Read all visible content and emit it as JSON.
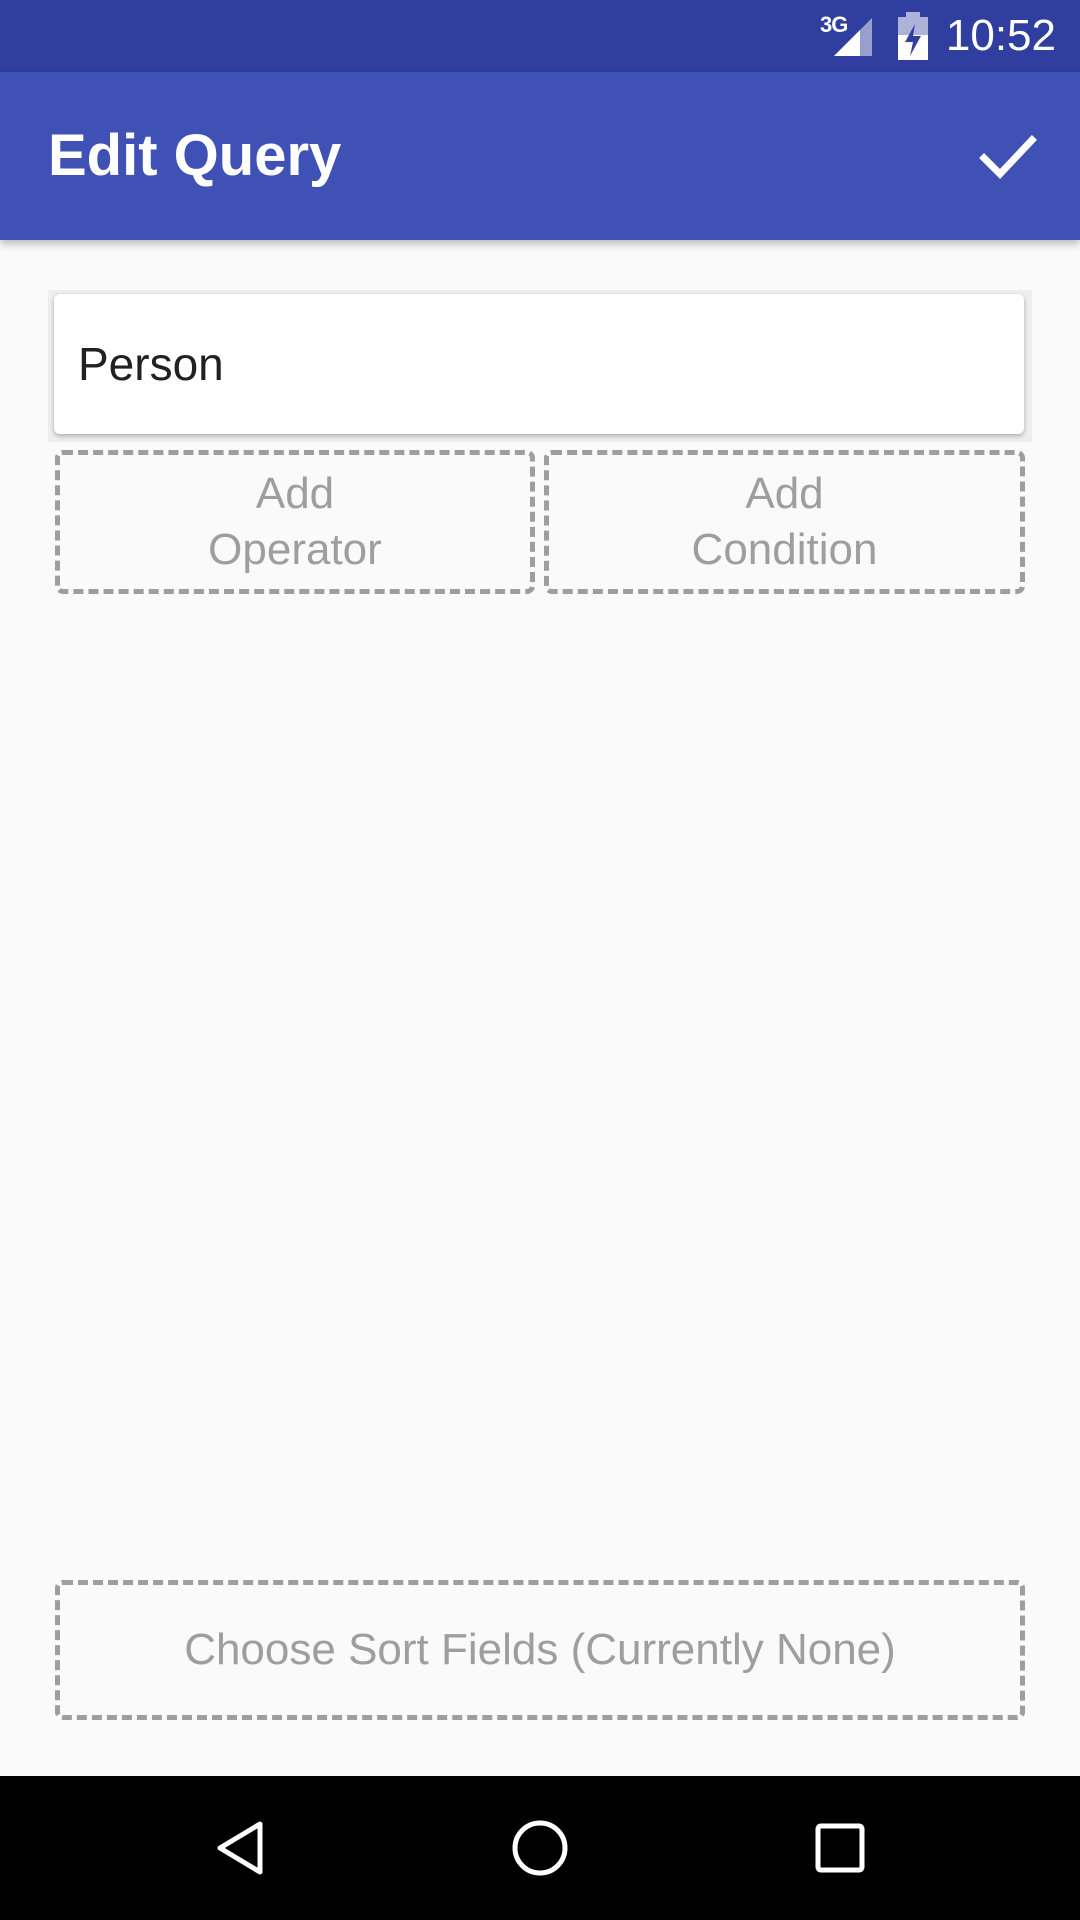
{
  "status_bar": {
    "network_type": "3G",
    "time": "10:52",
    "icons": [
      "signal-icon",
      "battery-charging-icon"
    ]
  },
  "app_bar": {
    "title": "Edit Query",
    "confirm_icon": "checkmark-icon"
  },
  "query": {
    "entity": "Person",
    "add_operator_line1": "Add",
    "add_operator_line2": "Operator",
    "add_condition_line1": "Add",
    "add_condition_line2": "Condition",
    "sort_fields_label": "Choose Sort Fields (Currently None)"
  },
  "nav_bar": {
    "icons": [
      "back-icon",
      "home-icon",
      "recents-icon"
    ]
  },
  "colors": {
    "status_bar": "#303f9f",
    "app_bar": "#3f51b5",
    "background": "#fafafa",
    "dashed_border": "#9e9e9e",
    "nav_bar": "#000000"
  }
}
